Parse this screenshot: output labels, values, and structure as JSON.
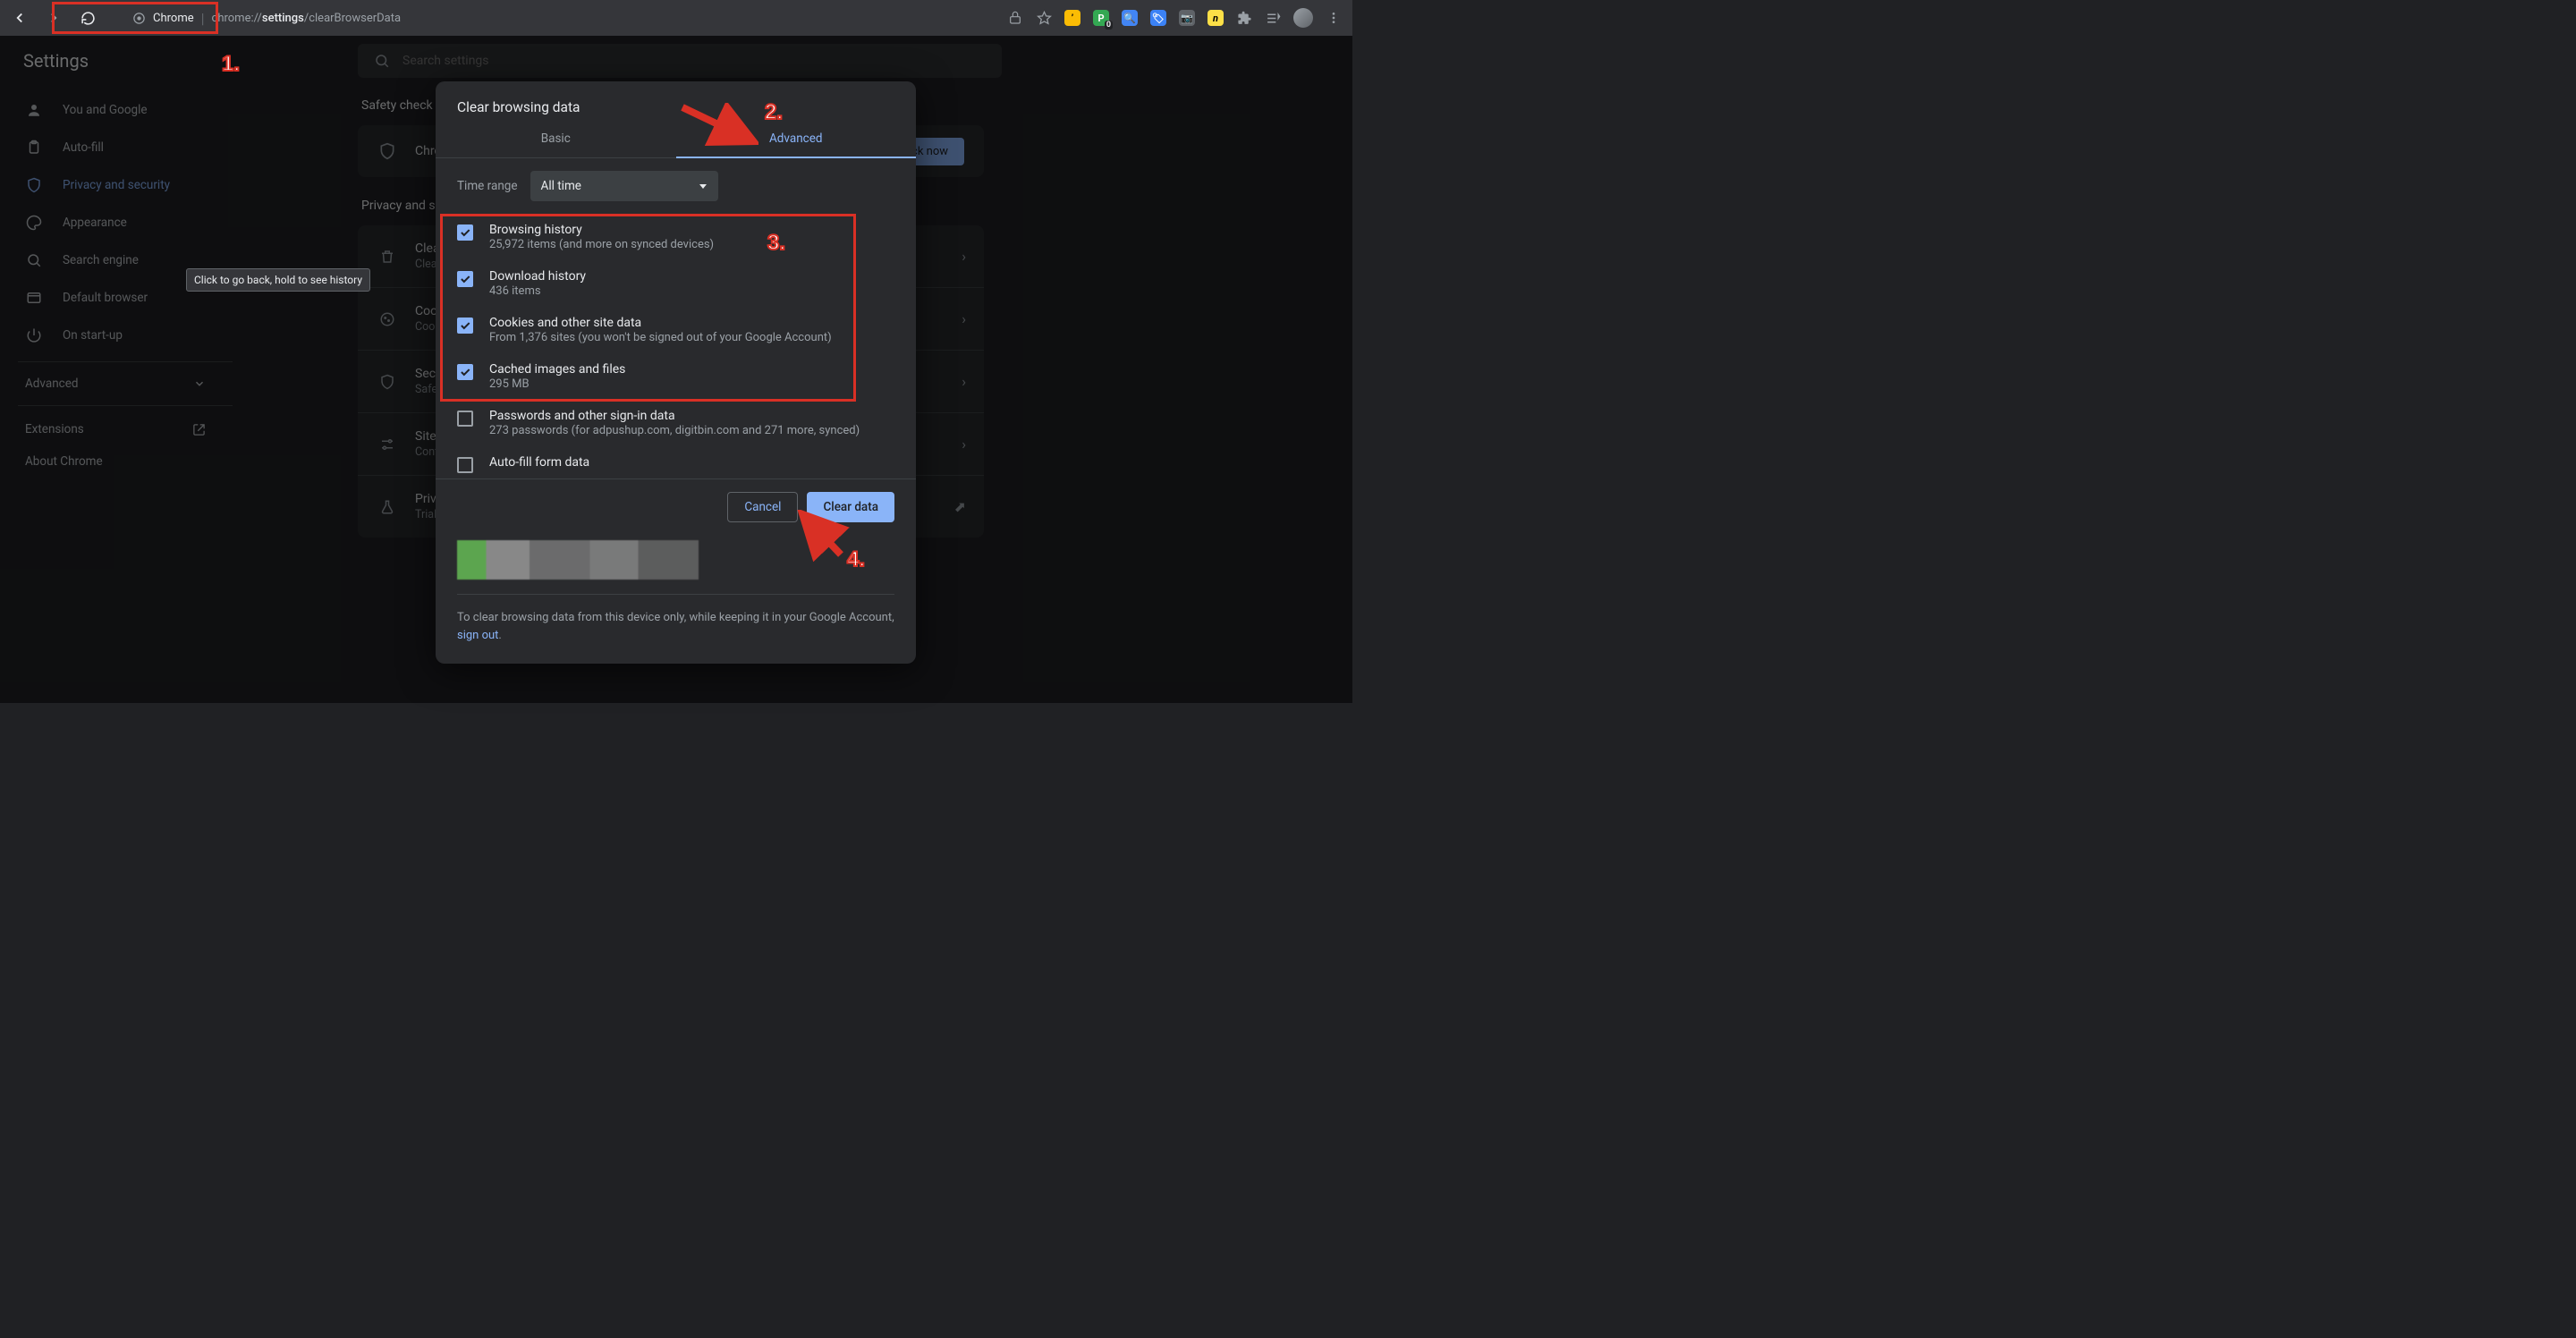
{
  "toolbar": {
    "chrome_label": "Chrome",
    "url_pre": "chrome://",
    "url_bold": "settings",
    "url_post": "/clearBrowserData"
  },
  "tooltip": "Click to go back, hold to see history",
  "header": {
    "title": "Settings",
    "search_placeholder": "Search settings"
  },
  "sidebar": {
    "items": [
      {
        "label": "You and Google"
      },
      {
        "label": "Auto-fill"
      },
      {
        "label": "Privacy and security"
      },
      {
        "label": "Appearance"
      },
      {
        "label": "Search engine"
      },
      {
        "label": "Default browser"
      },
      {
        "label": "On start-up"
      }
    ],
    "advanced": "Advanced",
    "extensions": "Extensions",
    "about": "About Chrome"
  },
  "content": {
    "safety_title": "Safety check",
    "safety_row": "Chrome can help keep you safe from data breaches, bad extensions and more",
    "check_now": "Check now",
    "privacy_title": "Privacy and security",
    "rows": [
      {
        "t1": "Clear browsing data",
        "t2": "Clear history, cookies, cache and more"
      },
      {
        "t1": "Cookies and other site data",
        "t2": "Cookies are allowed"
      },
      {
        "t1": "Security",
        "t2": "Safe Browsing (protection from dangerous sites) and other security settings"
      },
      {
        "t1": "Site settings",
        "t2": "Controls what information sites can use and show"
      },
      {
        "t1": "Privacy Sandbox",
        "t2": "Trial features are on"
      }
    ]
  },
  "modal": {
    "title": "Clear browsing data",
    "tabs": {
      "basic": "Basic",
      "advanced": "Advanced"
    },
    "time_range_label": "Time range",
    "time_range_value": "All time",
    "options": [
      {
        "t1": "Browsing history",
        "t2": "25,972 items (and more on synced devices)",
        "checked": true
      },
      {
        "t1": "Download history",
        "t2": "436 items",
        "checked": true
      },
      {
        "t1": "Cookies and other site data",
        "t2": "From 1,376 sites (you won't be signed out of your Google Account)",
        "checked": true
      },
      {
        "t1": "Cached images and files",
        "t2": "295 MB",
        "checked": true
      },
      {
        "t1": "Passwords and other sign-in data",
        "t2": "273 passwords (for adpushup.com, digitbin.com and 271 more, synced)",
        "checked": false
      },
      {
        "t1": "Auto-fill form data",
        "t2": "",
        "checked": false
      }
    ],
    "cancel": "Cancel",
    "clear": "Clear data",
    "footer_pre": "To clear browsing data from this device only, while keeping it in your Google Account, ",
    "footer_link": "sign out",
    "footer_post": "."
  },
  "annotations": {
    "n1": "1.",
    "n2": "2.",
    "n3": "3.",
    "n4": "4."
  }
}
